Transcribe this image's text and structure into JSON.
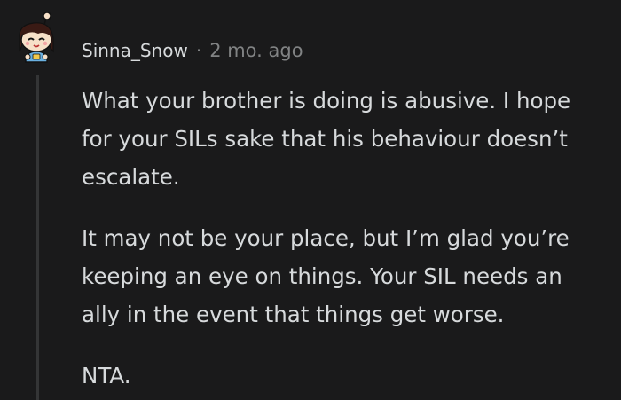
{
  "comment": {
    "username": "Sinna_Snow",
    "separator": "·",
    "timestamp": "2 mo. ago",
    "avatar_icon": "snoo-avatar-icon",
    "paragraphs": [
      "What your brother is doing is abusive. I hope for your SILs sake that his behaviour doesn’t escalate.",
      "It may not be your place, but I’m glad you’re keeping an eye on things. Your SIL needs an ally in the event that things get worse.",
      "NTA."
    ]
  },
  "colors": {
    "background": "#1a1a1b",
    "text": "#d7dadc",
    "meta": "#818384",
    "thread_line": "#343536"
  }
}
